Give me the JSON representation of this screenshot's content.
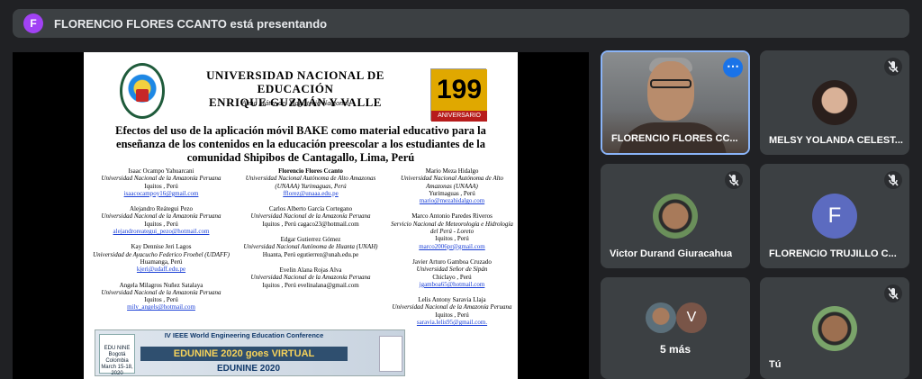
{
  "presenter_banner": {
    "avatar_letter": "F",
    "text": "FLORENCIO FLORES CCANTO está presentando"
  },
  "slide": {
    "university_line1": "UNIVERSIDAD NACIONAL DE EDUCACIÓN",
    "university_line2": "ENRIQUE GUZMÁN Y VALLE",
    "motto": "Alma Máter del Magisterio Nacional",
    "anniversary_number": "199",
    "anniversary_label": "ANIVERSARIO",
    "title": "Efectos del uso de la aplicación móvil BAKE como material educativo para la enseñanza de los contenidos en la educación preescolar a los estudiantes de la comunidad Shipibos de Cantagallo, Lima, Perú",
    "authors_col1": [
      {
        "name": "Isaac Ocampo Yahuarcani",
        "aff": "Universidad Nacional de la Amazonía Peruana",
        "loc": "Iquitos , Perú",
        "mail": "isaacocampoy16@gmail.com"
      },
      {
        "name": "Alejandro Reátegui Pezo",
        "aff": "Universidad Nacional de la Amazonía Peruana",
        "loc": "Iquitos , Perú",
        "mail": "alejandroreategui_pezo@hotmail.com"
      },
      {
        "name": "Kay Dennise Jeri Lagos",
        "aff": "Universidad de Ayacucho Federico Froebel (UDAFF)",
        "loc": "Huamanga, Perú",
        "mail": "kjeri@udaff.edu.pe"
      },
      {
        "name": "Angela Milagros Nuñez Satalaya",
        "aff": "Universidad Nacional de la Amazonía Peruana",
        "loc": "Iquitos , Perú",
        "mail": "mily_angels@hotmail.com"
      }
    ],
    "authors_col2": [
      {
        "name": "Florencio Flores Ccanto",
        "aff": "Universidad Nacional Autónoma de Alto Amazonas (UNAAA) Yurimaguas, Perú",
        "loc": "",
        "mail": "fflorez@unaaa.edu.pe"
      },
      {
        "name": "Carlos Alberto García Cortegano",
        "aff": "Universidad Nacional de la Amazonía Peruana",
        "loc": "Iquitos , Perú cagaco23@hotmail.com",
        "mail": ""
      },
      {
        "name": "Edgar Gutierrez Gómez",
        "aff": "Universidad Nacional Autónoma de Huanta (UNAH)",
        "loc": "Huanta, Perú egutierrez@unah.edu.pe",
        "mail": ""
      },
      {
        "name": "Evelin Alana Rojas Alva",
        "aff": "Universidad Nacional de la Amazonía Peruana",
        "loc": "Iquitos , Perú evelinalana@gmail.com",
        "mail": ""
      }
    ],
    "authors_col3": [
      {
        "name": "Mario Meza Hidalgo",
        "aff": "Universidad Nacional Autónoma de Alto Amazonas (UNAAA)",
        "loc": "Yurimaguas , Perú",
        "mail": "mario@mezahidalgo.com"
      },
      {
        "name": "Marco Antonio Paredes Riveros",
        "aff": "Servicio Nacional de Meteorología e Hidrología del Perú - Loreto",
        "loc": "Iquitos , Perú",
        "mail": "marco2006pr@gmail.com"
      },
      {
        "name": "Javier Arturo Gamboa Cruzado",
        "aff": "Universidad Señor de Sipán",
        "loc": "Chiclayo , Perú",
        "mail": "jgamboa65@hotmail.com"
      },
      {
        "name": "Lelis Antony Saravia Llaja",
        "aff": "Universidad Nacional de la Amazonía Peruana",
        "loc": "Iquitos , Perú",
        "mail": "saravia.lelis95@gmail.com."
      }
    ],
    "edunine_head": "IV IEEE World Engineering Education Conference",
    "edunine_banner": "EDUNINE 2020 goes VIRTUAL",
    "edunine_foot": "EDUNINE 2020",
    "edunine_logo": "EDU NINE Bogotá Colombia March 15-18, 2020"
  },
  "participants": [
    {
      "name": "FLORENCIO FLORES CC...",
      "state": "video"
    },
    {
      "name": "MELSY YOLANDA CELEST...",
      "state": "muted"
    },
    {
      "name": "Victor Durand Giuracahua",
      "state": "muted"
    },
    {
      "name": "FLORENCIO TRUJILLO C...",
      "state": "muted",
      "letter": "F"
    },
    {
      "name": "5 más",
      "state": "overflow",
      "letter": "V"
    },
    {
      "name": "Tú",
      "state": "muted"
    }
  ],
  "colors": {
    "background": "#202124",
    "tile": "#3c4043",
    "accent": "#1a73e8",
    "presenter_avatar": "#a142f4"
  }
}
